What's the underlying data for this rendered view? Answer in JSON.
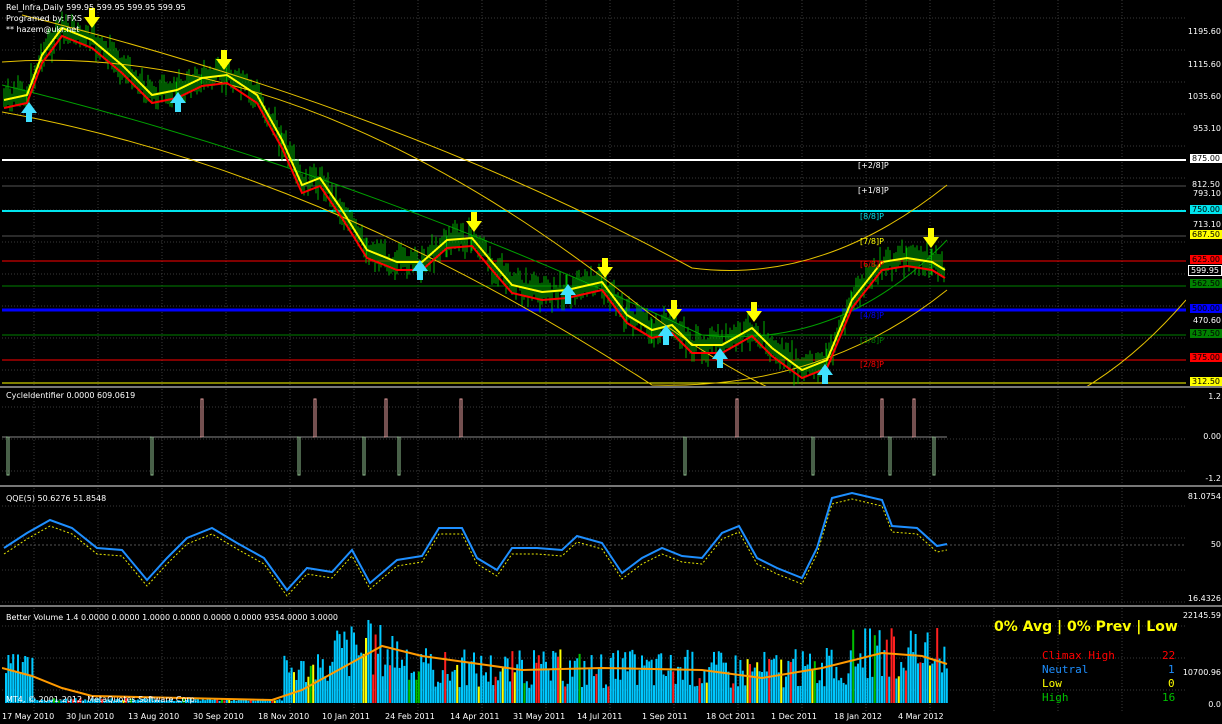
{
  "main_pane": {
    "title": "Rel_Infra,Daily  599.95 599.95 599.95 599.95",
    "subtitle": "Programed by: FXS",
    "credit": "** hazem@ukr.net",
    "price_axis": [
      "1195.60",
      "1115.60",
      "1035.60",
      "953.10",
      "875.00",
      "812.50",
      "793.10",
      "750.00",
      "713.10",
      "687.50",
      "599.95",
      "470.60",
      "312.50"
    ],
    "level_tags": [
      {
        "value": "875.00",
        "color": "#ffffff",
        "text": "#000"
      },
      {
        "value": "812.50",
        "color": "#000",
        "text": "#fff"
      },
      {
        "value": "750.00",
        "color": "#00e5ee",
        "text": "#000"
      },
      {
        "value": "687.50",
        "color": "#ffff00",
        "text": "#000"
      },
      {
        "value": "625.00",
        "color": "#ff0000",
        "text": "#000"
      },
      {
        "value": "599.95",
        "color": "#000",
        "text": "#fff"
      },
      {
        "value": "562.50",
        "color": "#008000",
        "text": "#000"
      },
      {
        "value": "500.00",
        "color": "#0000ff",
        "text": "#000"
      },
      {
        "value": "437.50",
        "color": "#008000",
        "text": "#000"
      },
      {
        "value": "375.00",
        "color": "#ff0000",
        "text": "#000"
      },
      {
        "value": "312.50",
        "color": "#ffff00",
        "text": "#000"
      }
    ],
    "murrey_labels": [
      {
        "text": "[+2/8]P",
        "color": "#ffffff"
      },
      {
        "text": "[+1/8]P",
        "color": "#ffffff"
      },
      {
        "text": "[8/8]P",
        "color": "#00e5ee"
      },
      {
        "text": "[7/8]P",
        "color": "#ffff00"
      },
      {
        "text": "[6/8]P",
        "color": "#ff0000"
      },
      {
        "text": "[4/8]P",
        "color": "#0000ff"
      },
      {
        "text": "[3/8]P",
        "color": "#008000"
      },
      {
        "text": "[2/8]P",
        "color": "#ff0000"
      }
    ],
    "colors": {
      "fast_ma": "#ffff00",
      "slow_ma": "#ff0000",
      "channel": "#e6c200",
      "candles": "#00c000"
    }
  },
  "cycle_pane": {
    "title": "CycleIdentifier 0.0000 609.0619",
    "axis": [
      "1.2",
      "0.00",
      "-1.2"
    ]
  },
  "qqe_pane": {
    "title": "QQE(5) 50.6276 51.8548",
    "axis": [
      "81.0754",
      "50",
      "16.4326"
    ],
    "colors": {
      "main": "#1e8fff",
      "signal": "#ffff00"
    }
  },
  "volume_pane": {
    "title": "Better Volume 1.4 0.0000 0.0000 1.0000 0.0000 0.0000 0.0000 9354.0000 3.0000",
    "axis": [
      "22145.59",
      "10700.96",
      "0.0"
    ],
    "copyright": "MT4, © 2001-2012, MetaQuotes Software Corp.",
    "stats_header": "0% Avg | 0% Prev | Low",
    "stats": [
      {
        "label": "Climax High",
        "value": "22",
        "color": "#ff0000"
      },
      {
        "label": "Neutral",
        "value": "1",
        "color": "#1e8fff"
      },
      {
        "label": "Low",
        "value": "0",
        "color": "#ffff00"
      },
      {
        "label": "High",
        "value": "16",
        "color": "#00c000"
      }
    ]
  },
  "dates": [
    "17 May 2010",
    "30 Jun 2010",
    "13 Aug 2010",
    "30 Sep 2010",
    "18 Nov 2010",
    "10 Jan 2011",
    "24 Feb 2011",
    "14 Apr 2011",
    "31 May 2011",
    "14 Jul 2011",
    "1 Sep 2011",
    "18 Oct 2011",
    "1 Dec 2011",
    "18 Jan 2012",
    "4 Mar 2012"
  ]
}
